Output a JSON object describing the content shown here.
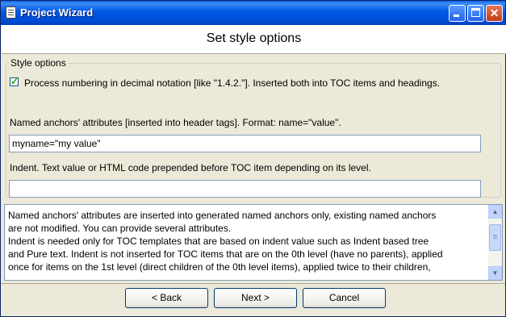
{
  "window": {
    "title": "Project Wizard"
  },
  "header": {
    "title": "Set style options"
  },
  "style_options": {
    "group_label": "Style options",
    "process_numbering": {
      "checked": true,
      "label": "Process numbering in decimal notation [like \"1.4.2.\"]. Inserted both into TOC items and headings."
    },
    "anchors_label": "Named anchors' attributes [inserted into header tags]. Format: name=\"value\".",
    "anchors_value": "myname=\"my value\"",
    "indent_label": "Indent. Text value or HTML code prepended before TOC item depending on its level.",
    "indent_value": ""
  },
  "info": {
    "text_lines": [
      "Named anchors' attributes are inserted into generated named anchors only, existing named anchors",
      "are not modified. You can provide several attributes.",
      "Indent is needed only for TOC templates that are based on indent value such as Indent based tree",
      "and Pure text. Indent is not inserted for TOC items that are on the 0th level (have no parents), applied",
      "once for items on the 1st level (direct children of the 0th level items), applied twice to their children,"
    ]
  },
  "buttons": {
    "back": "< Back",
    "next": "Next >",
    "cancel": "Cancel"
  },
  "icons": {
    "app": "document-icon",
    "check": "check-icon"
  }
}
